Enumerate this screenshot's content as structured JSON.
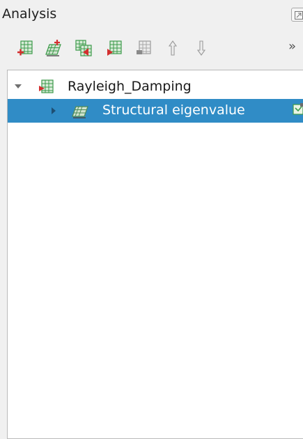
{
  "panel": {
    "title": "Analysis"
  },
  "toolbar": {
    "buttons": [
      {
        "name": "add-analysis-icon"
      },
      {
        "name": "add-sub-analysis-icon"
      },
      {
        "name": "copy-analysis-icon"
      },
      {
        "name": "run-analysis-icon"
      },
      {
        "name": "delete-analysis-icon"
      },
      {
        "name": "move-up-icon"
      },
      {
        "name": "move-down-icon"
      }
    ],
    "overflow": "»"
  },
  "tree": {
    "items": [
      {
        "label": "Rayleigh_Damping",
        "expanded": true,
        "selected": false
      },
      {
        "label": "Structural eigenvalue",
        "expanded": false,
        "selected": true
      }
    ]
  },
  "colors": {
    "selection": "#308cc6",
    "accent_green": "#3c9a4a",
    "accent_red": "#d32f2f"
  }
}
